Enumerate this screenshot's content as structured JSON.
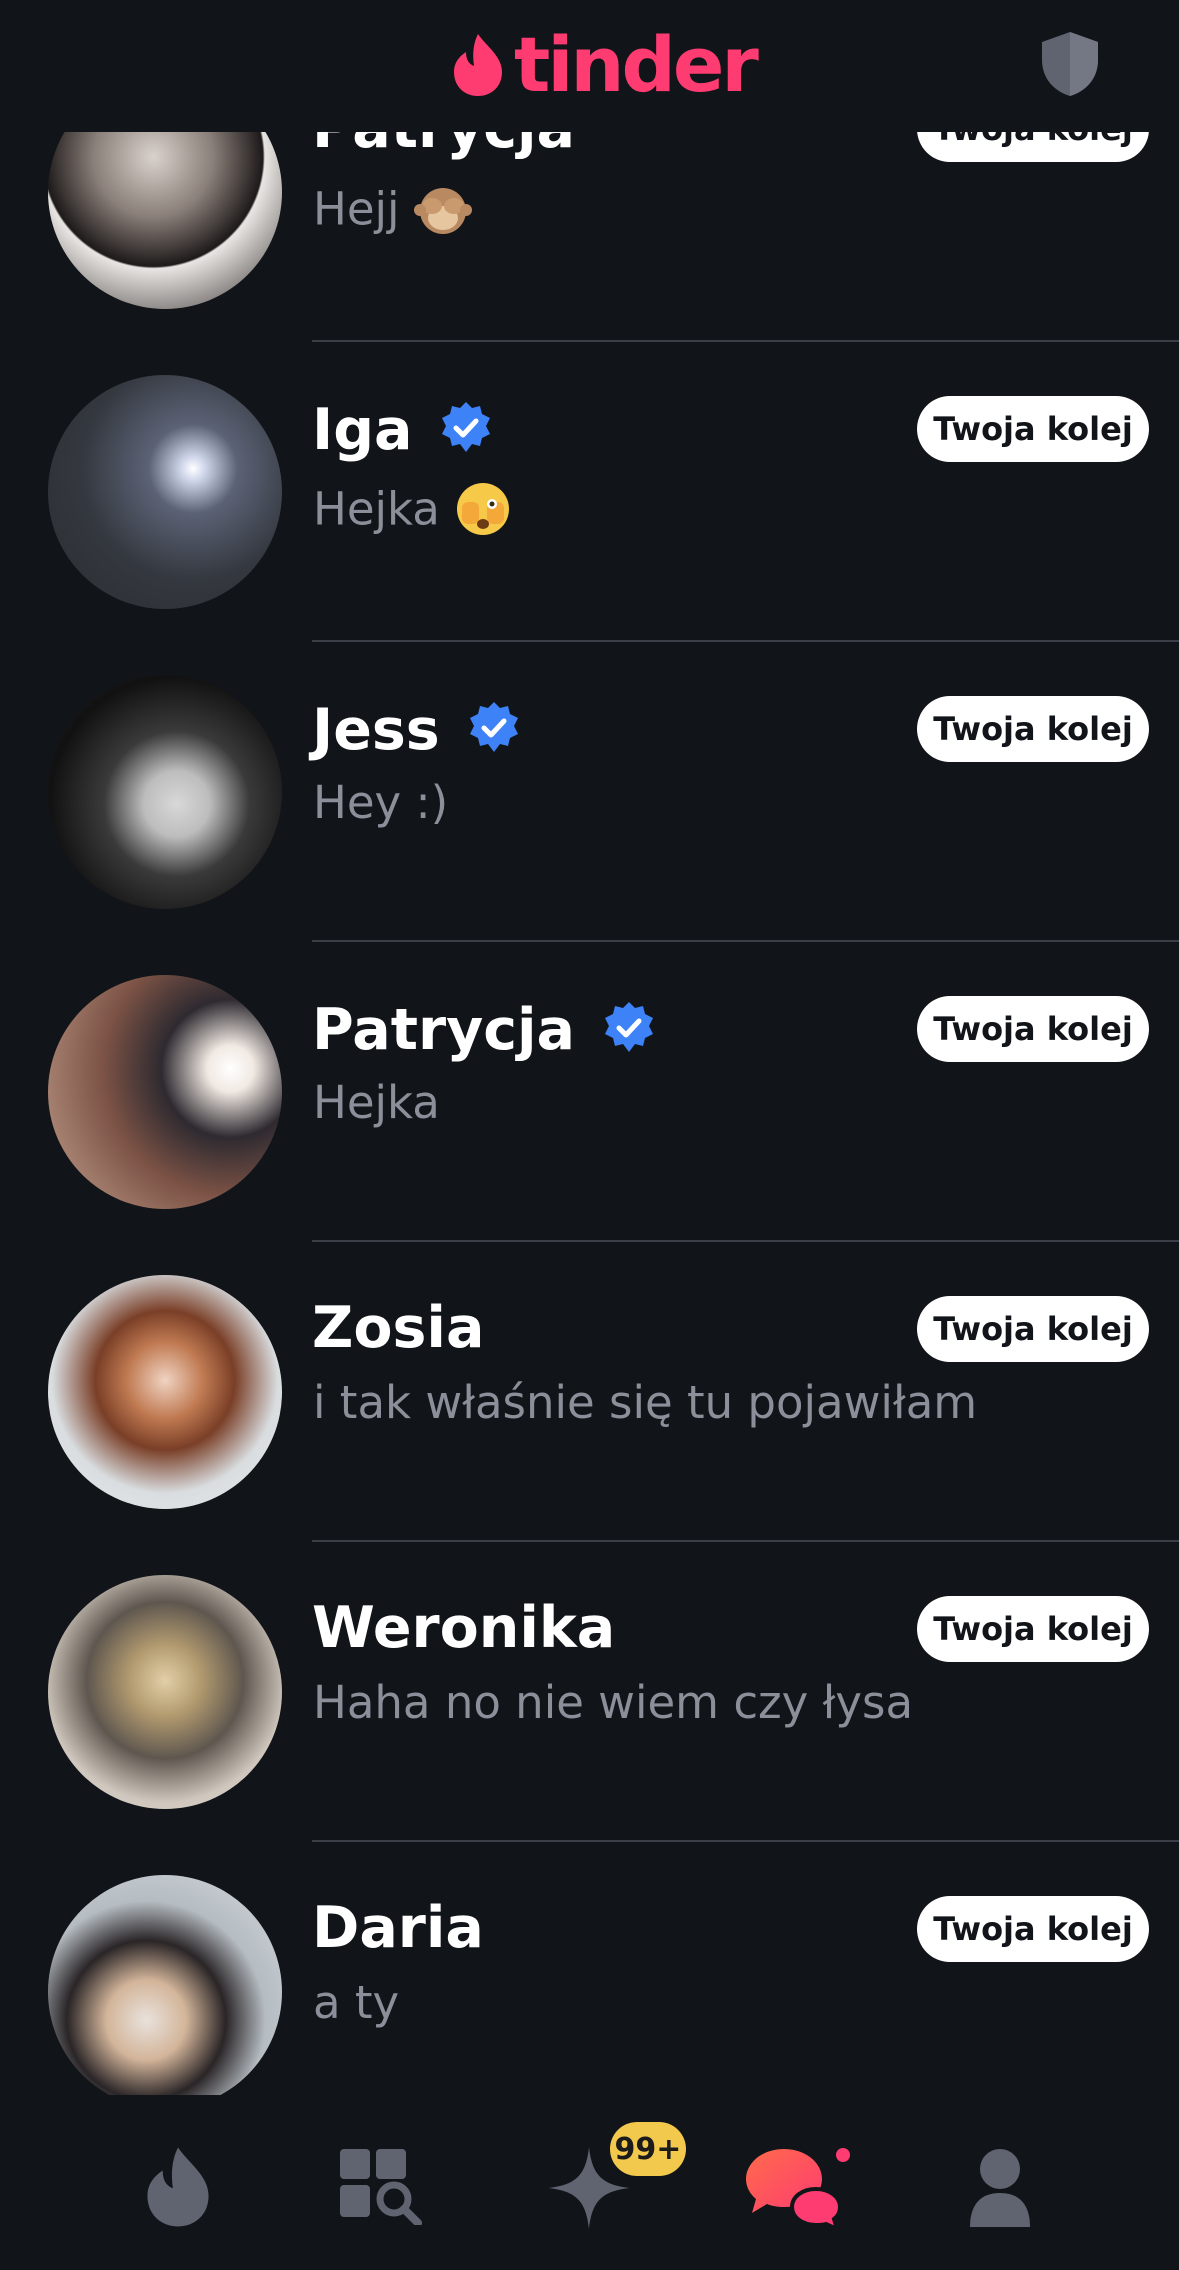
{
  "header": {
    "brand": "tinder",
    "brand_color": "#FE3C72",
    "safety_icon": "shield-icon"
  },
  "matches": [
    {
      "name": "Patrycja",
      "verified": false,
      "message": "Hejj",
      "emoji": "see-no-evil-monkey",
      "action": "Twoja kolej"
    },
    {
      "name": "Iga",
      "verified": true,
      "message": "Hejka",
      "emoji": "face-with-peeking-eye",
      "action": "Twoja kolej"
    },
    {
      "name": "Jess",
      "verified": true,
      "message": "Hey :)",
      "action": "Twoja kolej"
    },
    {
      "name": "Patrycja",
      "verified": true,
      "message": "Hejka",
      "action": "Twoja kolej"
    },
    {
      "name": "Zosia",
      "verified": false,
      "message": "i tak właśnie się tu pojawiłam",
      "action": "Twoja kolej"
    },
    {
      "name": "Weronika",
      "verified": false,
      "message": "Haha no nie wiem czy łysa",
      "action": "Twoja kolej"
    },
    {
      "name": "Daria",
      "verified": false,
      "message": "a ty",
      "action": "Twoja kolej"
    }
  ],
  "navbar": {
    "items": [
      "flame-icon",
      "explore-icon",
      "sparkle-icon",
      "chat-icon",
      "profile-icon"
    ],
    "badge": "99+",
    "active": "chat-icon"
  },
  "colors": {
    "background": "#111418",
    "verified": "#3D82F6",
    "muted_text": "#8b8f99",
    "badge": "#F2C94C"
  }
}
